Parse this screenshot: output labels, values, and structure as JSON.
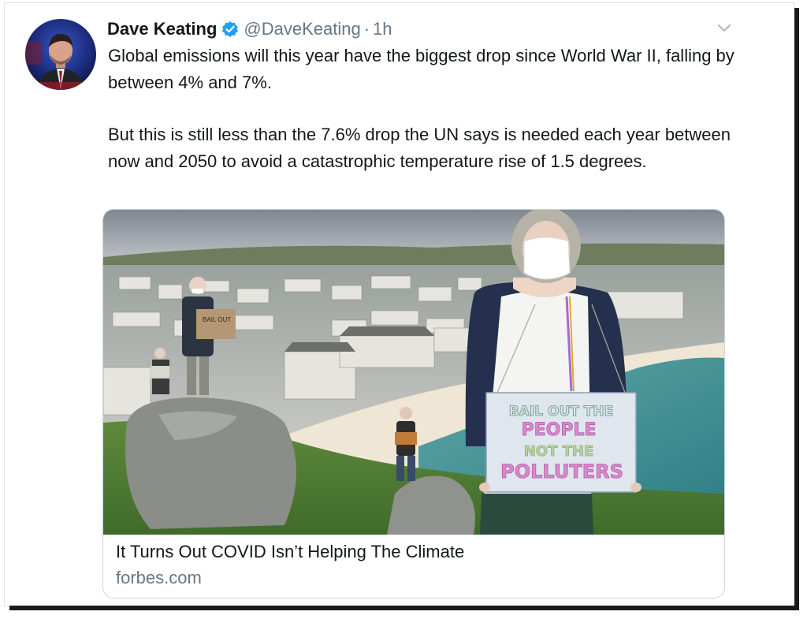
{
  "tweet": {
    "author_name": "Dave Keating",
    "handle": "@DaveKeating",
    "separator": "·",
    "time": "1h",
    "paragraphs": [
      "Global emissions will this year have the biggest drop since World War II, falling by between 4% and 7%.",
      "But this is still less than the 7.6% drop the UN says is needed each year between now and 2050 to avoid a catastrophic temperature rise of 1.5 degrees."
    ]
  },
  "card": {
    "title": "It Turns Out COVID Isn’t Helping The Climate",
    "domain": "forbes.com",
    "sign_lines": [
      "BAIL OUT THE",
      "PEOPLE",
      "NOT THE",
      "POLLUTERS"
    ],
    "small_sign_text": "BAIL OUT"
  },
  "icons": {
    "verified": "verified-badge-icon",
    "menu": "chevron-down-icon"
  },
  "colors": {
    "text": "#14171a",
    "secondary": "#657786",
    "verified": "#1da1f2",
    "border": "#ccd6dd"
  }
}
